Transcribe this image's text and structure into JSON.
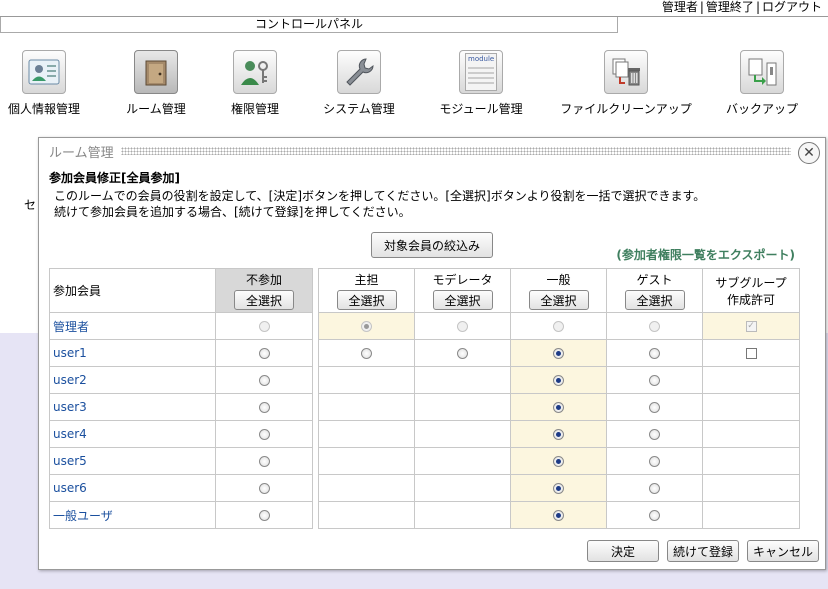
{
  "top_links": [
    "管理者",
    "管理終了",
    "ログアウト"
  ],
  "control_panel": {
    "title": "コントロールパネル"
  },
  "toolbar": [
    {
      "label": "個人情報管理",
      "icon": "user-card-icon"
    },
    {
      "label": "ルーム管理",
      "icon": "room-door-icon"
    },
    {
      "label": "権限管理",
      "icon": "user-key-icon"
    },
    {
      "label": "システム管理",
      "icon": "wrench-icon"
    },
    {
      "label": "モジュール管理",
      "icon": "module-icon",
      "icon_text": "module"
    },
    {
      "label": "ファイルクリーンアップ",
      "icon": "file-trash-icon"
    },
    {
      "label": "バックアップ",
      "icon": "backup-icon"
    }
  ],
  "background": {
    "fragment": "セ"
  },
  "dialog": {
    "title": "ルーム管理",
    "subtitle": "参加会員修正[全員参加]",
    "desc1": "このルームでの会員の役割を設定して、[決定]ボタンを押してください。[全選択]ボタンより役割を一括で選択できます。",
    "desc2": "続けて参加会員を追加する場合、[続けて登録]を押してください。",
    "filter_label": "対象会員の絞込み",
    "export_label": "(参加者権限一覧をエクスポート)",
    "member_header": "参加会員",
    "select_all": "全選択",
    "columns": [
      "不参加",
      "主担",
      "モデレータ",
      "一般",
      "ゲスト"
    ],
    "subgroup_header_1": "サブグループ",
    "subgroup_header_2": "作成許可",
    "rows": [
      {
        "name": "管理者",
        "role": 1,
        "locked": true,
        "subgroup": true
      },
      {
        "name": "user1",
        "role": 3,
        "locked": false,
        "subgroup": false
      },
      {
        "name": "user2",
        "role": 3,
        "locked": false
      },
      {
        "name": "user3",
        "role": 3,
        "locked": false
      },
      {
        "name": "user4",
        "role": 3,
        "locked": false
      },
      {
        "name": "user5",
        "role": 3,
        "locked": false
      },
      {
        "name": "user6",
        "role": 3,
        "locked": false
      },
      {
        "name": "一般ユーザ",
        "role": 3,
        "locked": false
      }
    ],
    "buttons": {
      "ok": "決定",
      "continue": "続けて登録",
      "cancel": "キャンセル"
    }
  }
}
